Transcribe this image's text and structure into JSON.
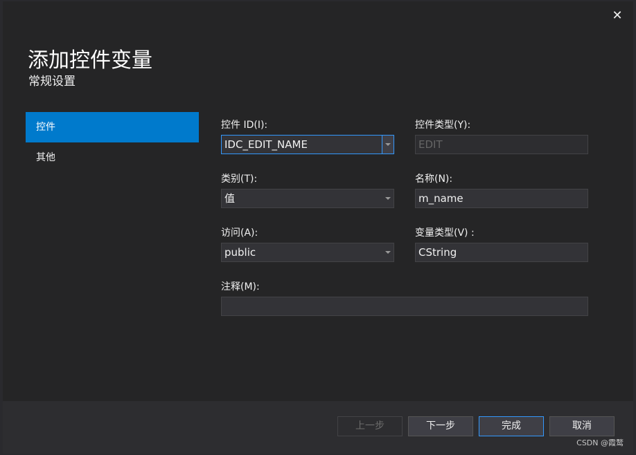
{
  "dialog": {
    "title": "添加控件变量",
    "subtitle": "常规设置",
    "close_glyph": "✕"
  },
  "nav": {
    "items": [
      {
        "label": "控件",
        "selected": true
      },
      {
        "label": "其他",
        "selected": false
      }
    ]
  },
  "form": {
    "control_id": {
      "label": "控件 ID(I):",
      "value": "IDC_EDIT_NAME"
    },
    "control_type": {
      "label": "控件类型(Y):",
      "value": "EDIT"
    },
    "category": {
      "label": "类别(T):",
      "value": "值"
    },
    "name": {
      "label": "名称(N):",
      "value": "m_name"
    },
    "access": {
      "label": "访问(A):",
      "value": "public"
    },
    "variable_type": {
      "label": "变量类型(V) :",
      "value": "CString"
    },
    "comment": {
      "label": "注释(M):",
      "value": ""
    }
  },
  "footer": {
    "prev_label": "上一步",
    "next_label": "下一步",
    "finish_label": "完成",
    "cancel_label": "取消"
  },
  "watermark": "CSDN @霞鹜",
  "colors": {
    "accent": "#007acc",
    "focus_border": "#3399ff",
    "dialog_bg": "#252526"
  }
}
